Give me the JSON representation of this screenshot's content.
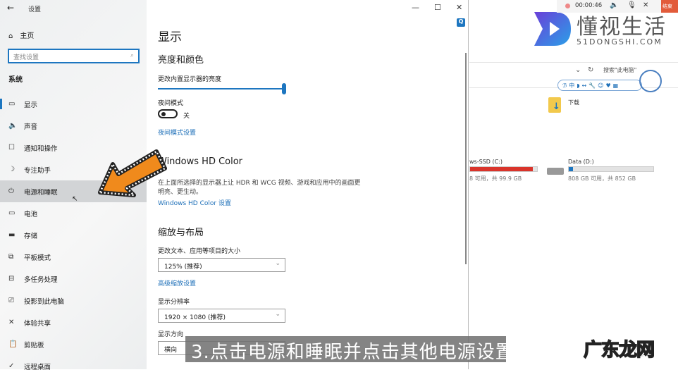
{
  "window": {
    "title": "设置",
    "minimize": "—",
    "maximize": "☐",
    "close": "✕"
  },
  "sidebar": {
    "home": "主页",
    "search_placeholder": "查找设置",
    "section": "系统",
    "items": [
      {
        "icon": "▭",
        "label": "显示"
      },
      {
        "icon": "🔈",
        "label": "声音"
      },
      {
        "icon": "☐",
        "label": "通知和操作"
      },
      {
        "icon": "☽",
        "label": "专注助手"
      },
      {
        "icon": "⏻",
        "label": "电源和睡眠"
      },
      {
        "icon": "▭",
        "label": "电池"
      },
      {
        "icon": "▬",
        "label": "存储"
      },
      {
        "icon": "⧉",
        "label": "平板模式"
      },
      {
        "icon": "⊟",
        "label": "多任务处理"
      },
      {
        "icon": "⎚",
        "label": "投影到此电脑"
      },
      {
        "icon": "✕",
        "label": "体验共享"
      },
      {
        "icon": "📋",
        "label": "剪贴板"
      },
      {
        "icon": "✓",
        "label": "远程桌面"
      }
    ]
  },
  "main": {
    "title": "显示",
    "brightness_heading": "亮度和颜色",
    "brightness_label": "更改内置显示器的亮度",
    "brightness_value": 100,
    "night_label": "夜间模式",
    "night_state": "关",
    "night_link": "夜间模式设置",
    "hd_heading": "Windows HD Color",
    "hd_desc1": "在上面所选择的显示器上让 HDR 和 WCG 视频、游戏和应用中的画面更",
    "hd_desc2": "明亮、更生动。",
    "hd_link": "Windows HD Color 设置",
    "scale_heading": "缩放与布局",
    "scale_label": "更改文本、应用等项目的大小",
    "scale_value": "125% (推荐)",
    "scale_link": "高级缩放设置",
    "res_label": "显示分辨率",
    "res_value": "1920 × 1080 (推荐)",
    "orient_label": "显示方向",
    "orient_value": "横向"
  },
  "recorder": {
    "time": "00:00:46",
    "end": "结束"
  },
  "logo": {
    "name": "懂视生活",
    "site": "51DONGSHI.COM"
  },
  "explorer": {
    "search": "搜索\"此电脑\"",
    "folder": "下载",
    "drives": [
      {
        "name": "ws-SSD (C:)",
        "free": "8 可用，共 99.9 GB",
        "used_pct": 94,
        "color": "#d9342b"
      },
      {
        "name": "Data (D:)",
        "free": "808 GB 可用，共 852 GB",
        "used_pct": 5,
        "color": "#1d76c0"
      }
    ]
  },
  "ime": "ℬ中◗↔🔧☺♥▦",
  "caption": "3.点击电源和睡眠并点击其他电源设置",
  "watermark": "广东龙网",
  "watermark2": "生活"
}
